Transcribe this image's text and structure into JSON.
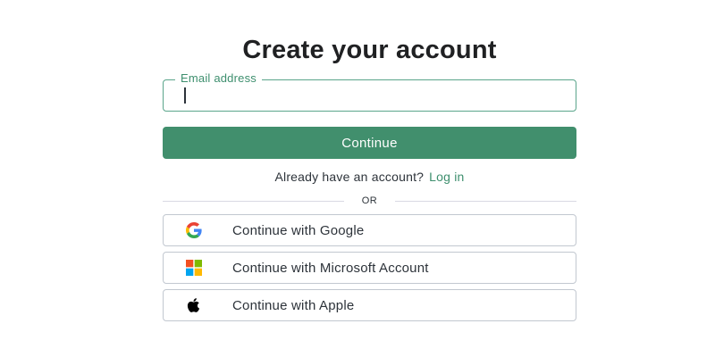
{
  "heading": "Create your account",
  "email": {
    "label": "Email address",
    "value": "",
    "focus_color": "#5aa58b"
  },
  "continue_label": "Continue",
  "login_prompt": {
    "text": "Already have an account?",
    "link": "Log in"
  },
  "divider_text": "OR",
  "social": {
    "google": {
      "label": "Continue with Google",
      "icon": "google-icon"
    },
    "microsoft": {
      "label": "Continue with Microsoft Account",
      "icon": "microsoft-icon"
    },
    "apple": {
      "label": "Continue with Apple",
      "icon": "apple-icon"
    }
  },
  "colors": {
    "accent": "#418f6d",
    "link": "#3e8f6e",
    "text": "#2d333a",
    "border": "#c2c8d0"
  }
}
